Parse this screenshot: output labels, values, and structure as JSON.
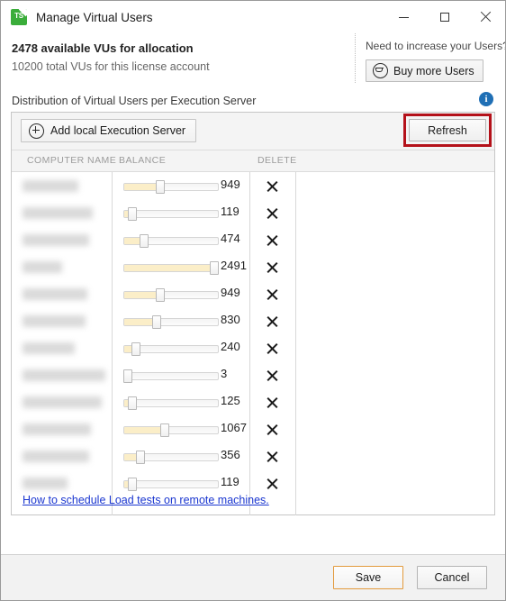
{
  "window": {
    "title": "Manage Virtual Users",
    "app_icon": "ts-logo-icon",
    "icon_text": "TS",
    "controls": {
      "minimize": "minimize-icon",
      "maximize": "maximize-icon",
      "close": "close-icon"
    }
  },
  "summary": {
    "available_line": "2478 available VUs for allocation",
    "total_line": "10200 total VUs for this license account",
    "promo_question": "Need to increase your Users?",
    "buy_button": "Buy more Users"
  },
  "distribution": {
    "section_label": "Distribution of Virtual Users per Execution Server",
    "info_icon_text": "i",
    "add_button": "Add local Execution Server",
    "refresh_button": "Refresh",
    "highlight_color": "#b4111a",
    "columns": [
      "COMPUTER NAME",
      "BALANCE",
      "DELETE"
    ],
    "slider_max": 2500,
    "rows": [
      {
        "name": "",
        "balance": "949",
        "value": 949,
        "delete": "delete-icon"
      },
      {
        "name": "",
        "balance": "119",
        "value": 119,
        "delete": "delete-icon"
      },
      {
        "name": "",
        "balance": "474",
        "value": 474,
        "delete": "delete-icon"
      },
      {
        "name": "",
        "balance": "2491",
        "value": 2491,
        "delete": "delete-icon"
      },
      {
        "name": "",
        "balance": "949",
        "value": 949,
        "delete": "delete-icon"
      },
      {
        "name": "",
        "balance": "830",
        "value": 830,
        "delete": "delete-icon"
      },
      {
        "name": "",
        "balance": "240",
        "value": 240,
        "delete": "delete-icon"
      },
      {
        "name": "",
        "balance": "3",
        "value": 3,
        "delete": "delete-icon"
      },
      {
        "name": "",
        "balance": "125",
        "value": 125,
        "delete": "delete-icon"
      },
      {
        "name": "",
        "balance": "1067",
        "value": 1067,
        "delete": "delete-icon"
      },
      {
        "name": "",
        "balance": "356",
        "value": 356,
        "delete": "delete-icon"
      },
      {
        "name": "",
        "balance": "119",
        "value": 119,
        "delete": "delete-icon"
      }
    ],
    "help_link": "How to schedule Load tests on remote machines."
  },
  "footer": {
    "save_label": "Save",
    "cancel_label": "Cancel",
    "save_focus_color": "#e39a3c"
  }
}
